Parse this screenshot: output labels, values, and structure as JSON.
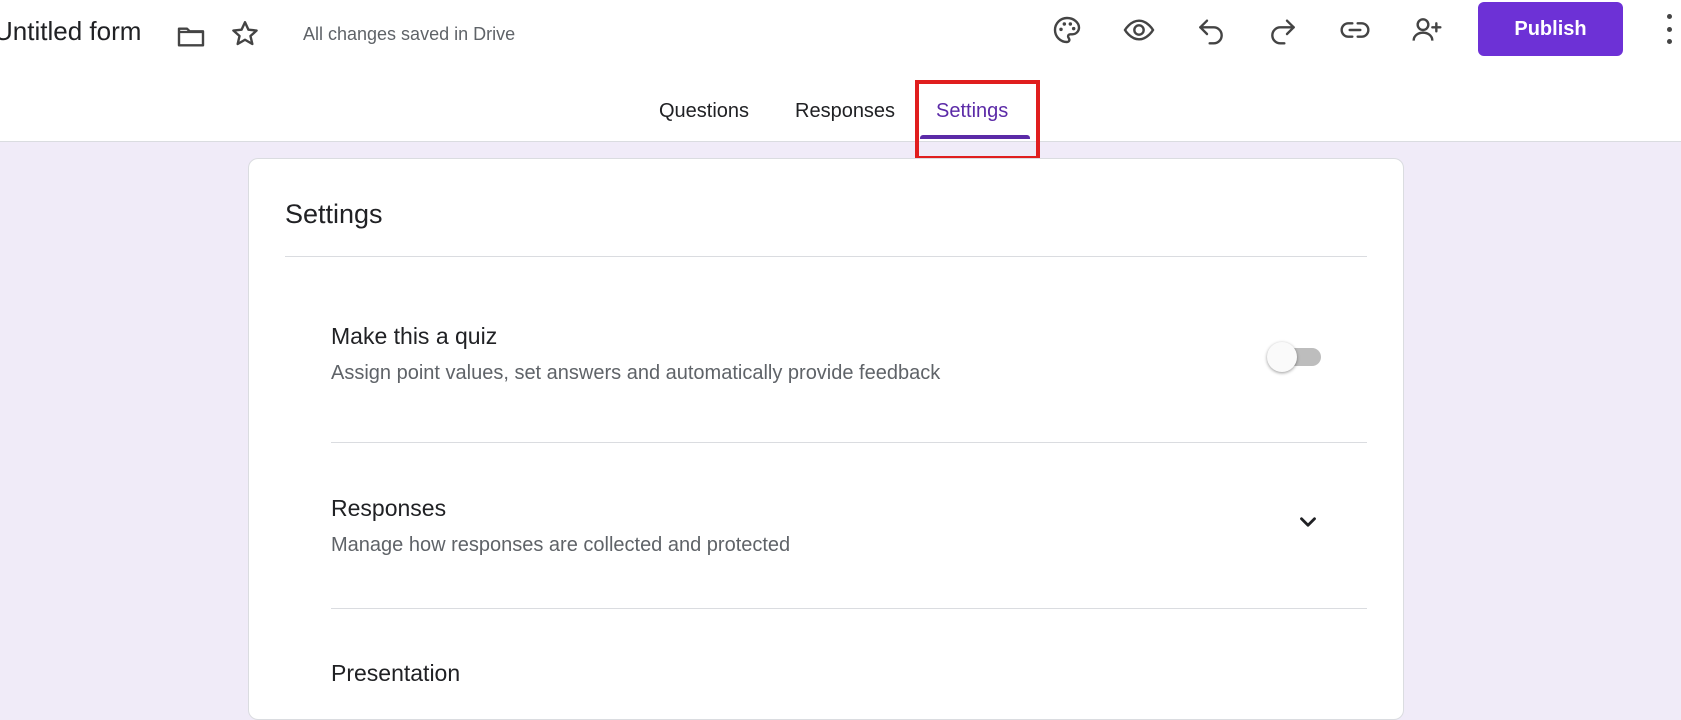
{
  "header": {
    "title": "Untitled form",
    "saved_status": "All changes saved in Drive",
    "publish_label": "Publish"
  },
  "tabs": [
    {
      "label": "Questions",
      "active": false
    },
    {
      "label": "Responses",
      "active": false
    },
    {
      "label": "Settings",
      "active": true
    }
  ],
  "settings_card": {
    "title": "Settings",
    "items": [
      {
        "title": "Make this a quiz",
        "description": "Assign point values, set answers and automatically provide feedback",
        "control": "toggle",
        "enabled": false
      },
      {
        "title": "Responses",
        "description": "Manage how responses are collected and protected",
        "control": "expand"
      },
      {
        "title": "Presentation",
        "description": "",
        "control": "expand"
      }
    ]
  },
  "icons": [
    "folder-icon",
    "star-icon",
    "palette-icon",
    "eye-icon",
    "undo-icon",
    "redo-icon",
    "link-icon",
    "add-person-icon",
    "more-vert-icon",
    "chevron-down-icon"
  ],
  "colors": {
    "accent": "#6d31d6",
    "active_tab": "#5b2aa7",
    "background": "#f0ebf8",
    "highlight_box": "#e01e1e"
  }
}
